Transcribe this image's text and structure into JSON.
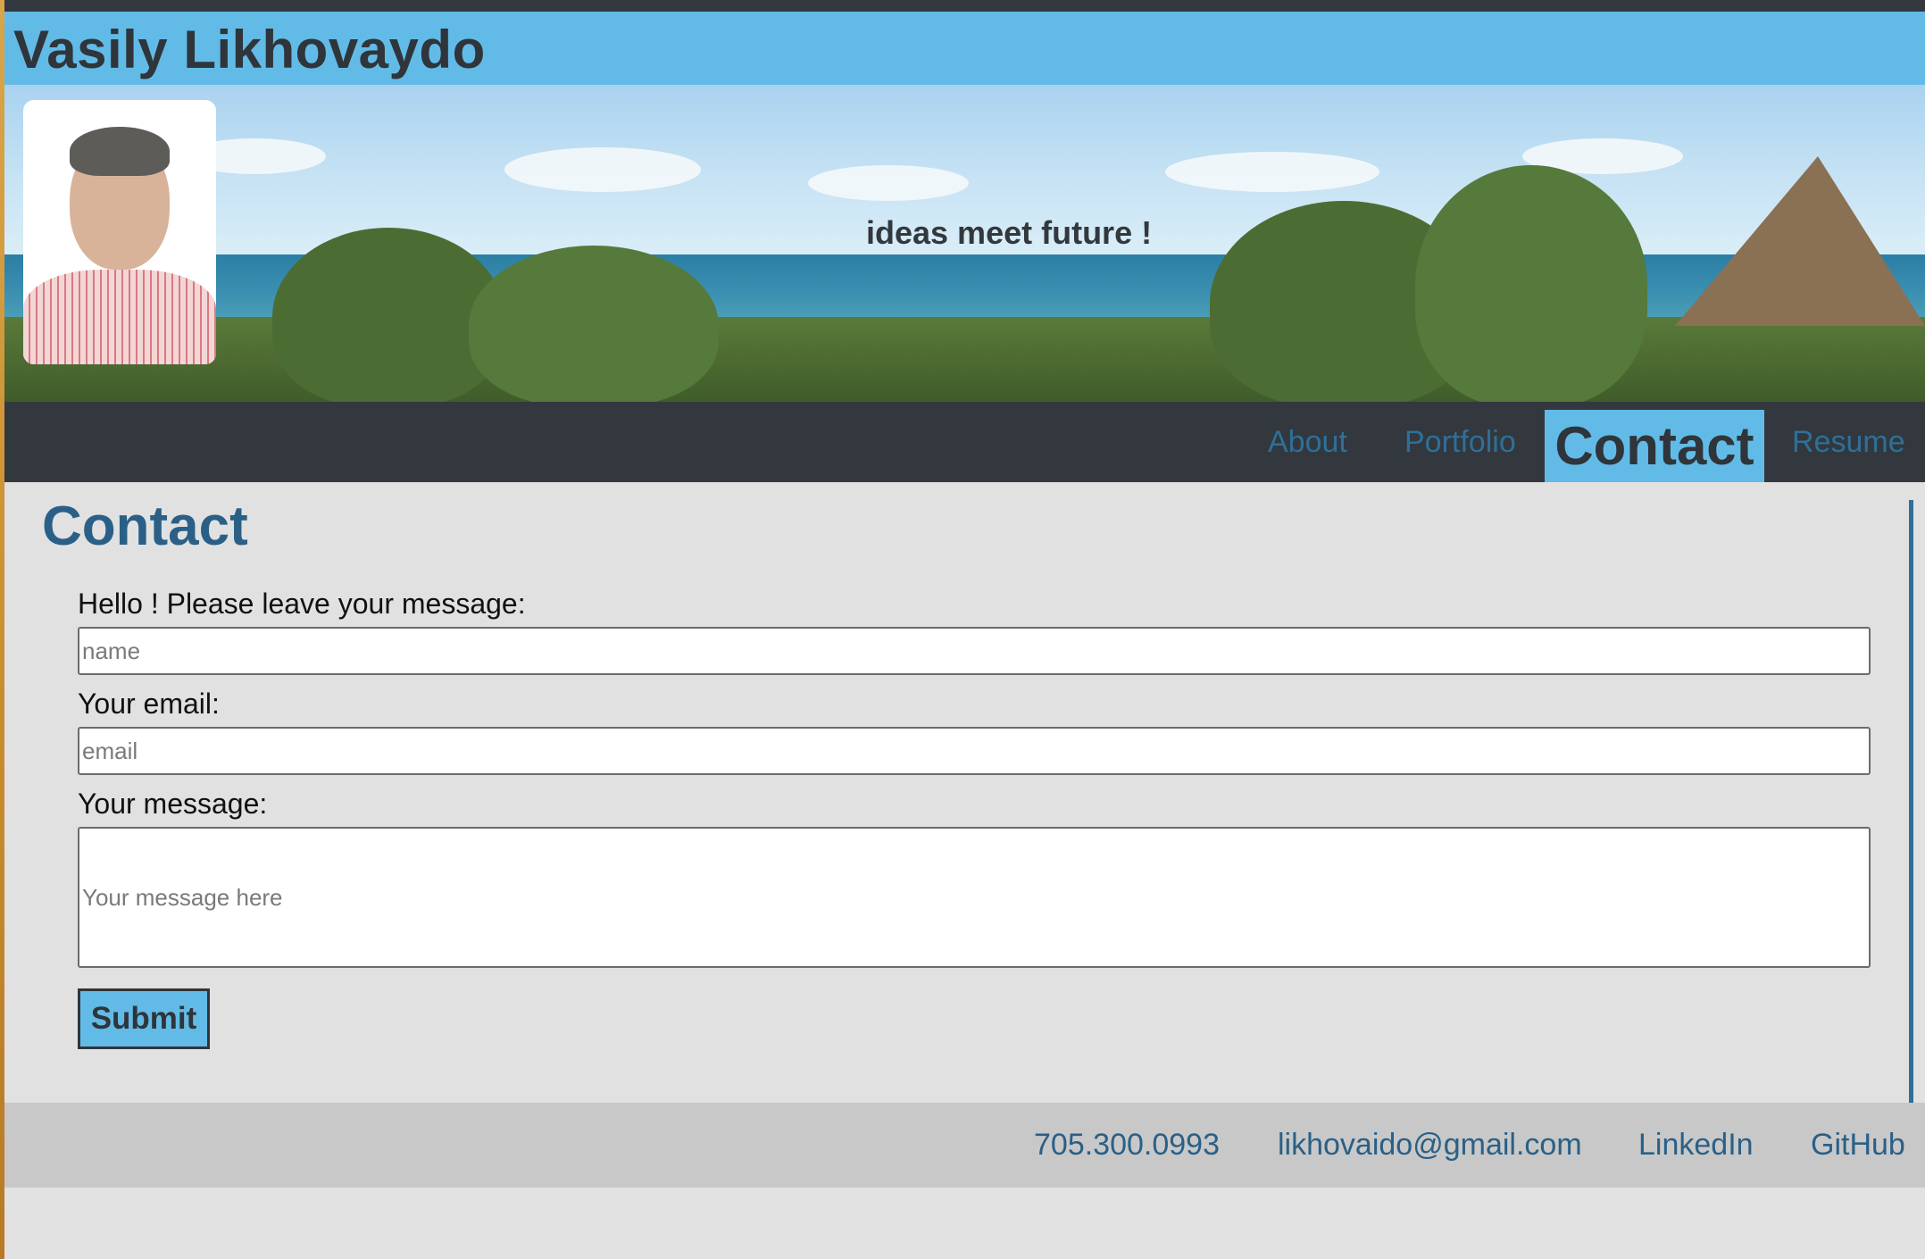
{
  "site": {
    "name": "Vasily Likhovaydo"
  },
  "hero": {
    "tagline": "ideas meet future !"
  },
  "nav": {
    "items": [
      {
        "label": "About"
      },
      {
        "label": "Portfolio"
      },
      {
        "label": "Contact",
        "active": true
      },
      {
        "label": "Resume"
      }
    ]
  },
  "contact": {
    "title": "Contact",
    "name_label": "Hello ! Please leave your message:",
    "name_placeholder": "name",
    "email_label": "Your email:",
    "email_placeholder": "email",
    "message_label": "Your message:",
    "message_placeholder": "Your message here",
    "submit_label": "Submit"
  },
  "footer": {
    "phone": "705.300.0993",
    "email": "likhovaido@gmail.com",
    "linkedin": "LinkedIn",
    "github": "GitHub"
  },
  "colors": {
    "accent": "#62bbe7",
    "dark": "#32383d",
    "link": "#2a6087",
    "background": "#e1e1e1",
    "footer": "#c8c8c8"
  }
}
